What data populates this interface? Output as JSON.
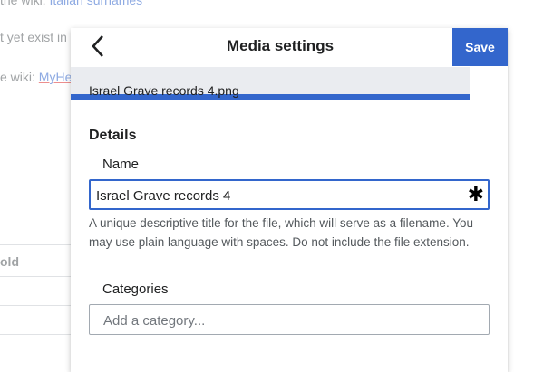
{
  "background": {
    "line1_text": "the wiki: ",
    "line1_link": "Italian surnames",
    "line2_text": "t yet exist in",
    "line3_text": "e wiki: ",
    "line3_link": "MyHe",
    "column_header": "old"
  },
  "dialog": {
    "title": "Media settings",
    "back_icon": "chevron-left-icon",
    "save_label": "Save",
    "file_name": "Israel Grave records 4.png",
    "section_title": "Details",
    "name_label": "Name",
    "name_value": "Israel Grave records 4",
    "required_icon": "asterisk-icon",
    "help_text": "A unique descriptive title for the file, which will serve as a filename. You may use plain language with spaces. Do not include the file extension.",
    "categories_label": "Categories",
    "categories_placeholder": "Add a category..."
  },
  "colors": {
    "accent": "#3366cc",
    "file_bar": "#eaecf0",
    "border": "#a2a9b1"
  }
}
